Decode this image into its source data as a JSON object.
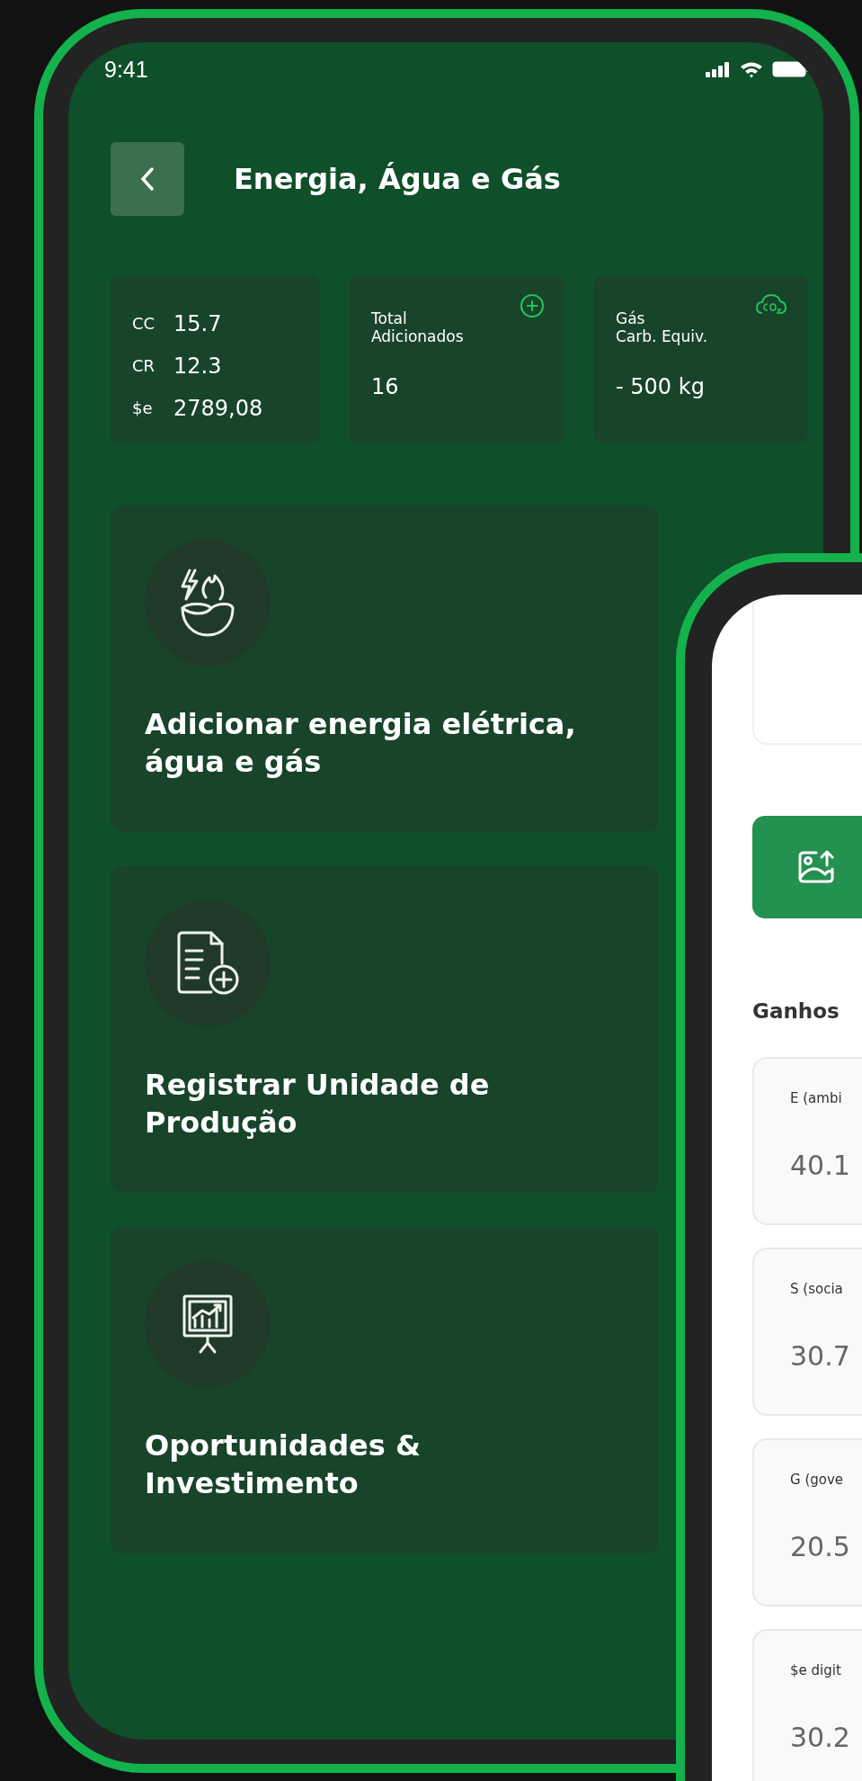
{
  "status_bar": {
    "time": "9:41"
  },
  "header": {
    "title": "Energia, Água e Gás"
  },
  "stats": [
    {
      "kind": "metrics",
      "rows": [
        {
          "label": "CC",
          "value": "15.7"
        },
        {
          "label": "CR",
          "value": "12.3"
        },
        {
          "label": "$e",
          "value": "2789,08"
        }
      ]
    },
    {
      "kind": "total",
      "label": "Total\nAdicionados",
      "value": "16"
    },
    {
      "kind": "carbon",
      "label": "Gás\nCarb. Equiv.",
      "value": "- 500 kg"
    }
  ],
  "actions": [
    {
      "kind": "utilities",
      "label": "Adicionar energia elétrica,\nágua e gás"
    },
    {
      "kind": "register",
      "label": "Registrar Unidade de\nProdução"
    },
    {
      "kind": "investment",
      "label": "Oportunidades &\nInvestimento"
    }
  ],
  "second_screen": {
    "section_title": "Ganhos",
    "fields": [
      {
        "label": "E (ambi",
        "value": "40.1"
      },
      {
        "label": "S (socia",
        "value": "30.7"
      },
      {
        "label": "G (gove",
        "value": "20.5"
      },
      {
        "label": "$e digit",
        "value": "30.2"
      }
    ]
  }
}
